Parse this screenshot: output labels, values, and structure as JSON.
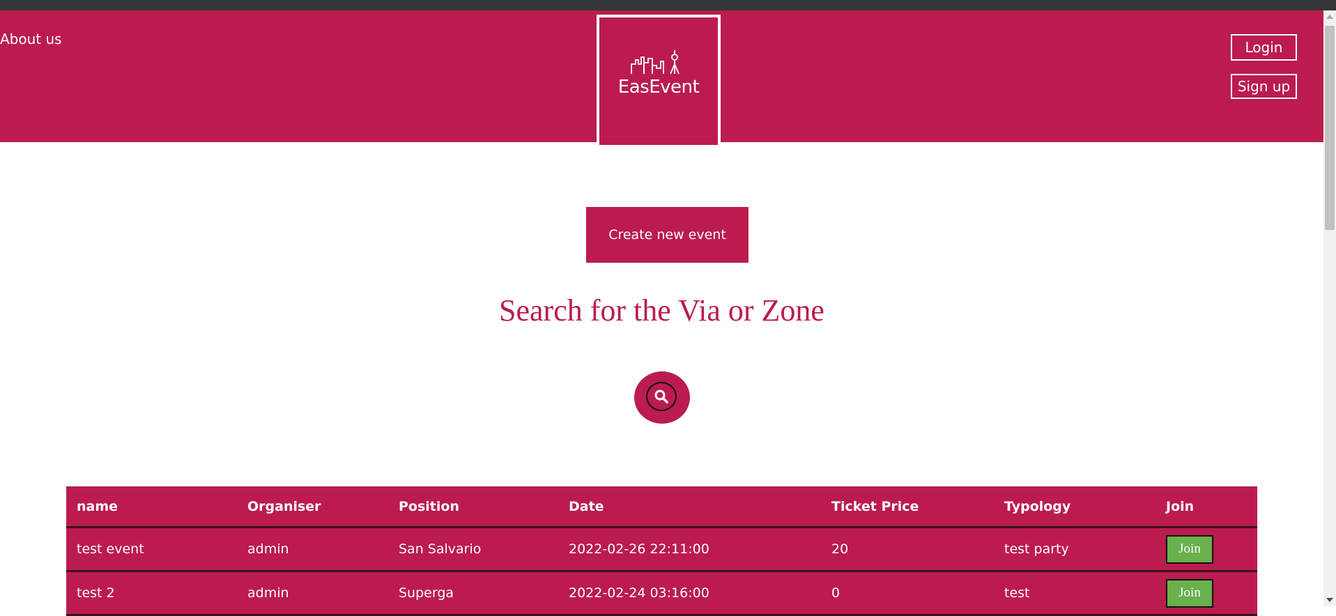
{
  "header": {
    "about_label": "About us",
    "logo_text": "EasEvent",
    "login_label": "Login",
    "signup_label": "Sign up",
    "brand_color": "#bb1c4d"
  },
  "main": {
    "create_label": "Create new event",
    "search_title": "Search for the Via or Zone",
    "search_icon": "search-icon"
  },
  "table": {
    "headers": [
      "name",
      "Organiser",
      "Position",
      "Date",
      "Ticket Price",
      "Typology",
      "Join"
    ],
    "rows": [
      {
        "name": "test event",
        "organiser": "admin",
        "position": "San Salvario",
        "date": "2022-02-26 22:11:00",
        "price": "20",
        "typology": "test party",
        "join": "Join"
      },
      {
        "name": "test 2",
        "organiser": "admin",
        "position": "Superga",
        "date": "2022-02-24 03:16:00",
        "price": "0",
        "typology": "test",
        "join": "Join"
      }
    ],
    "join_color": "#6ab04c"
  }
}
